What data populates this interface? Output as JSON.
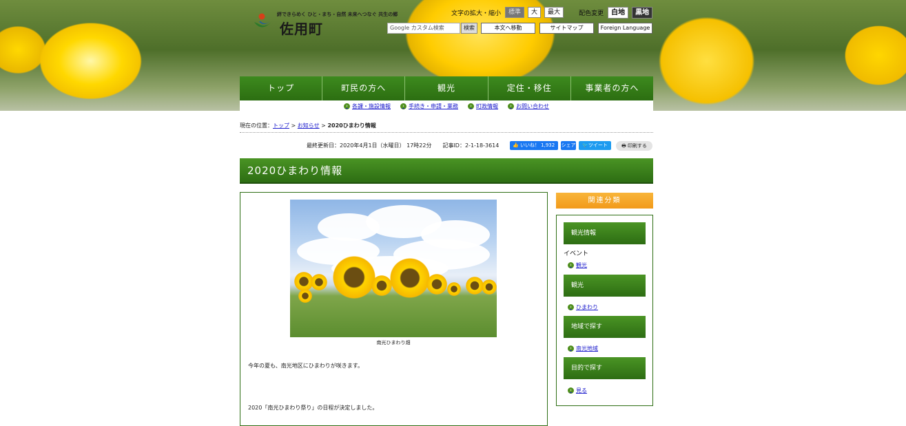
{
  "header": {
    "logo": {
      "tagline": "絆できらめく ひと・まち・自然 未来へつなぐ 共生の郷",
      "name": "佐用町"
    },
    "font_size": {
      "label": "文字の拡大・縮小",
      "options": [
        "標準",
        "大",
        "最大"
      ]
    },
    "color_change": {
      "label": "配色変更",
      "options": [
        "白地",
        "黒地"
      ]
    },
    "search": {
      "placeholder": "Google カスタム検索",
      "button": "検索"
    },
    "links": [
      "本文へ移動",
      "サイトマップ",
      "Foreign Language"
    ]
  },
  "global_nav": [
    "トップ",
    "町民の方へ",
    "観光",
    "定住・移住",
    "事業者の方へ"
  ],
  "sub_nav": [
    "各課・施設情報",
    "手続き・申請・業務",
    "町政情報",
    "お問い合わせ"
  ],
  "breadcrumb": {
    "label": "現在の位置：",
    "items": [
      "トップ",
      "お知らせ"
    ],
    "current": "2020ひまわり情報"
  },
  "meta": {
    "updated": "最終更新日：2020年4月1日（水曜日） 17時22分",
    "article_id": "記事ID：2-1-18-3614",
    "like": "いいね！ 1,932",
    "share": "シェア",
    "tweet": "ツイート",
    "print": "印刷する"
  },
  "page_title": "2020ひまわり情報",
  "content": {
    "photo_caption": "南光ひまわり畑",
    "para1": "今年の夏も、南光地区にひまわりが咲きます。",
    "para2": "2020「南光ひまわり祭り」の日程が決定しました。"
  },
  "sidebar": {
    "heading": "関連分類",
    "sections": [
      {
        "title": "観光情報",
        "sub": "イベント",
        "link": "観光"
      },
      {
        "title": "観光",
        "link": "ひまわり"
      },
      {
        "title": "地域で探す",
        "link": "南光地域"
      },
      {
        "title": "目的で探す",
        "link": "見る"
      }
    ]
  }
}
